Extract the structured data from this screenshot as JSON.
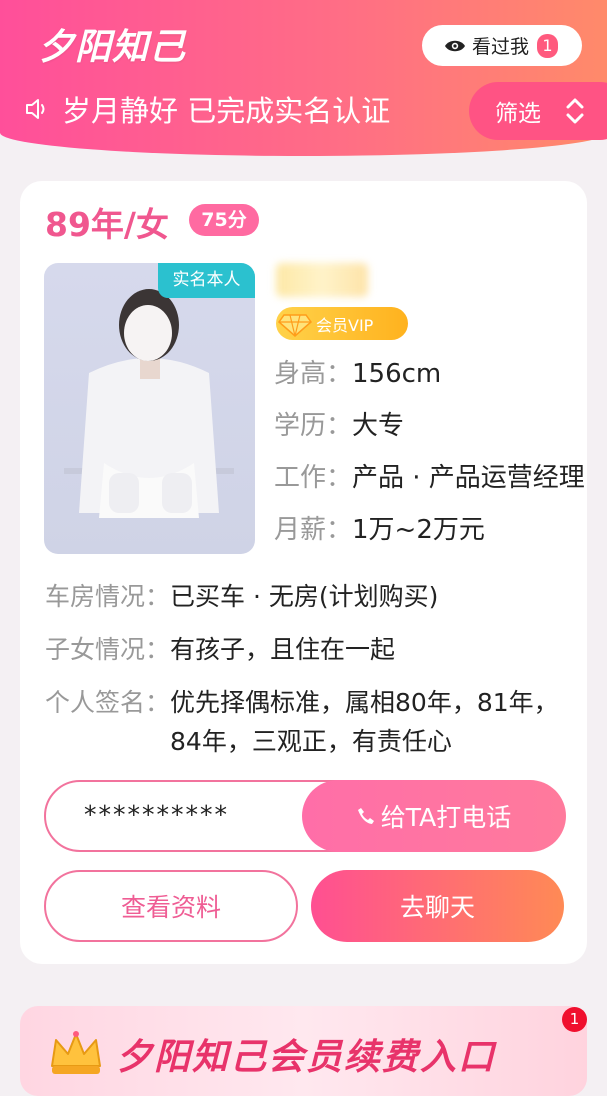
{
  "header": {
    "logo": "夕阳知己",
    "seen_me": {
      "label": "看过我",
      "count": "1"
    },
    "notice": "岁月静好 已完成实名认证",
    "filter_label": "筛选"
  },
  "profile": {
    "age_sex": "89年/女",
    "score": "75分",
    "verified_tag": "实名本人",
    "vip_label": "会员VIP",
    "height": {
      "label": "身高：",
      "value": "156cm"
    },
    "education": {
      "label": "学历：",
      "value": "大专"
    },
    "job": {
      "label": "工作：",
      "value": "产品 · 产品运营经理"
    },
    "salary": {
      "label": "月薪：",
      "value": "1万~2万元"
    },
    "car_house": {
      "label": "车房情况：",
      "value": "已买车 · 无房(计划购买)"
    },
    "children": {
      "label": "子女情况：",
      "value": "有孩子，且住在一起"
    },
    "signature": {
      "label": "个人签名：",
      "value": "优先择偶标准，属相80年，81年，84年，三观正，有责任心"
    },
    "phone_masked": "**********",
    "call_label": "给TA打电话",
    "view_label": "查看资料",
    "chat_label": "去聊天"
  },
  "banner": {
    "title": "夕阳知己会员续费入口",
    "badge": "1"
  },
  "colors": {
    "brand_pink": "#ff4f9a",
    "brand_orange": "#ff8a6a",
    "accent_text": "#f0578f",
    "verified": "#2bc1cf"
  }
}
